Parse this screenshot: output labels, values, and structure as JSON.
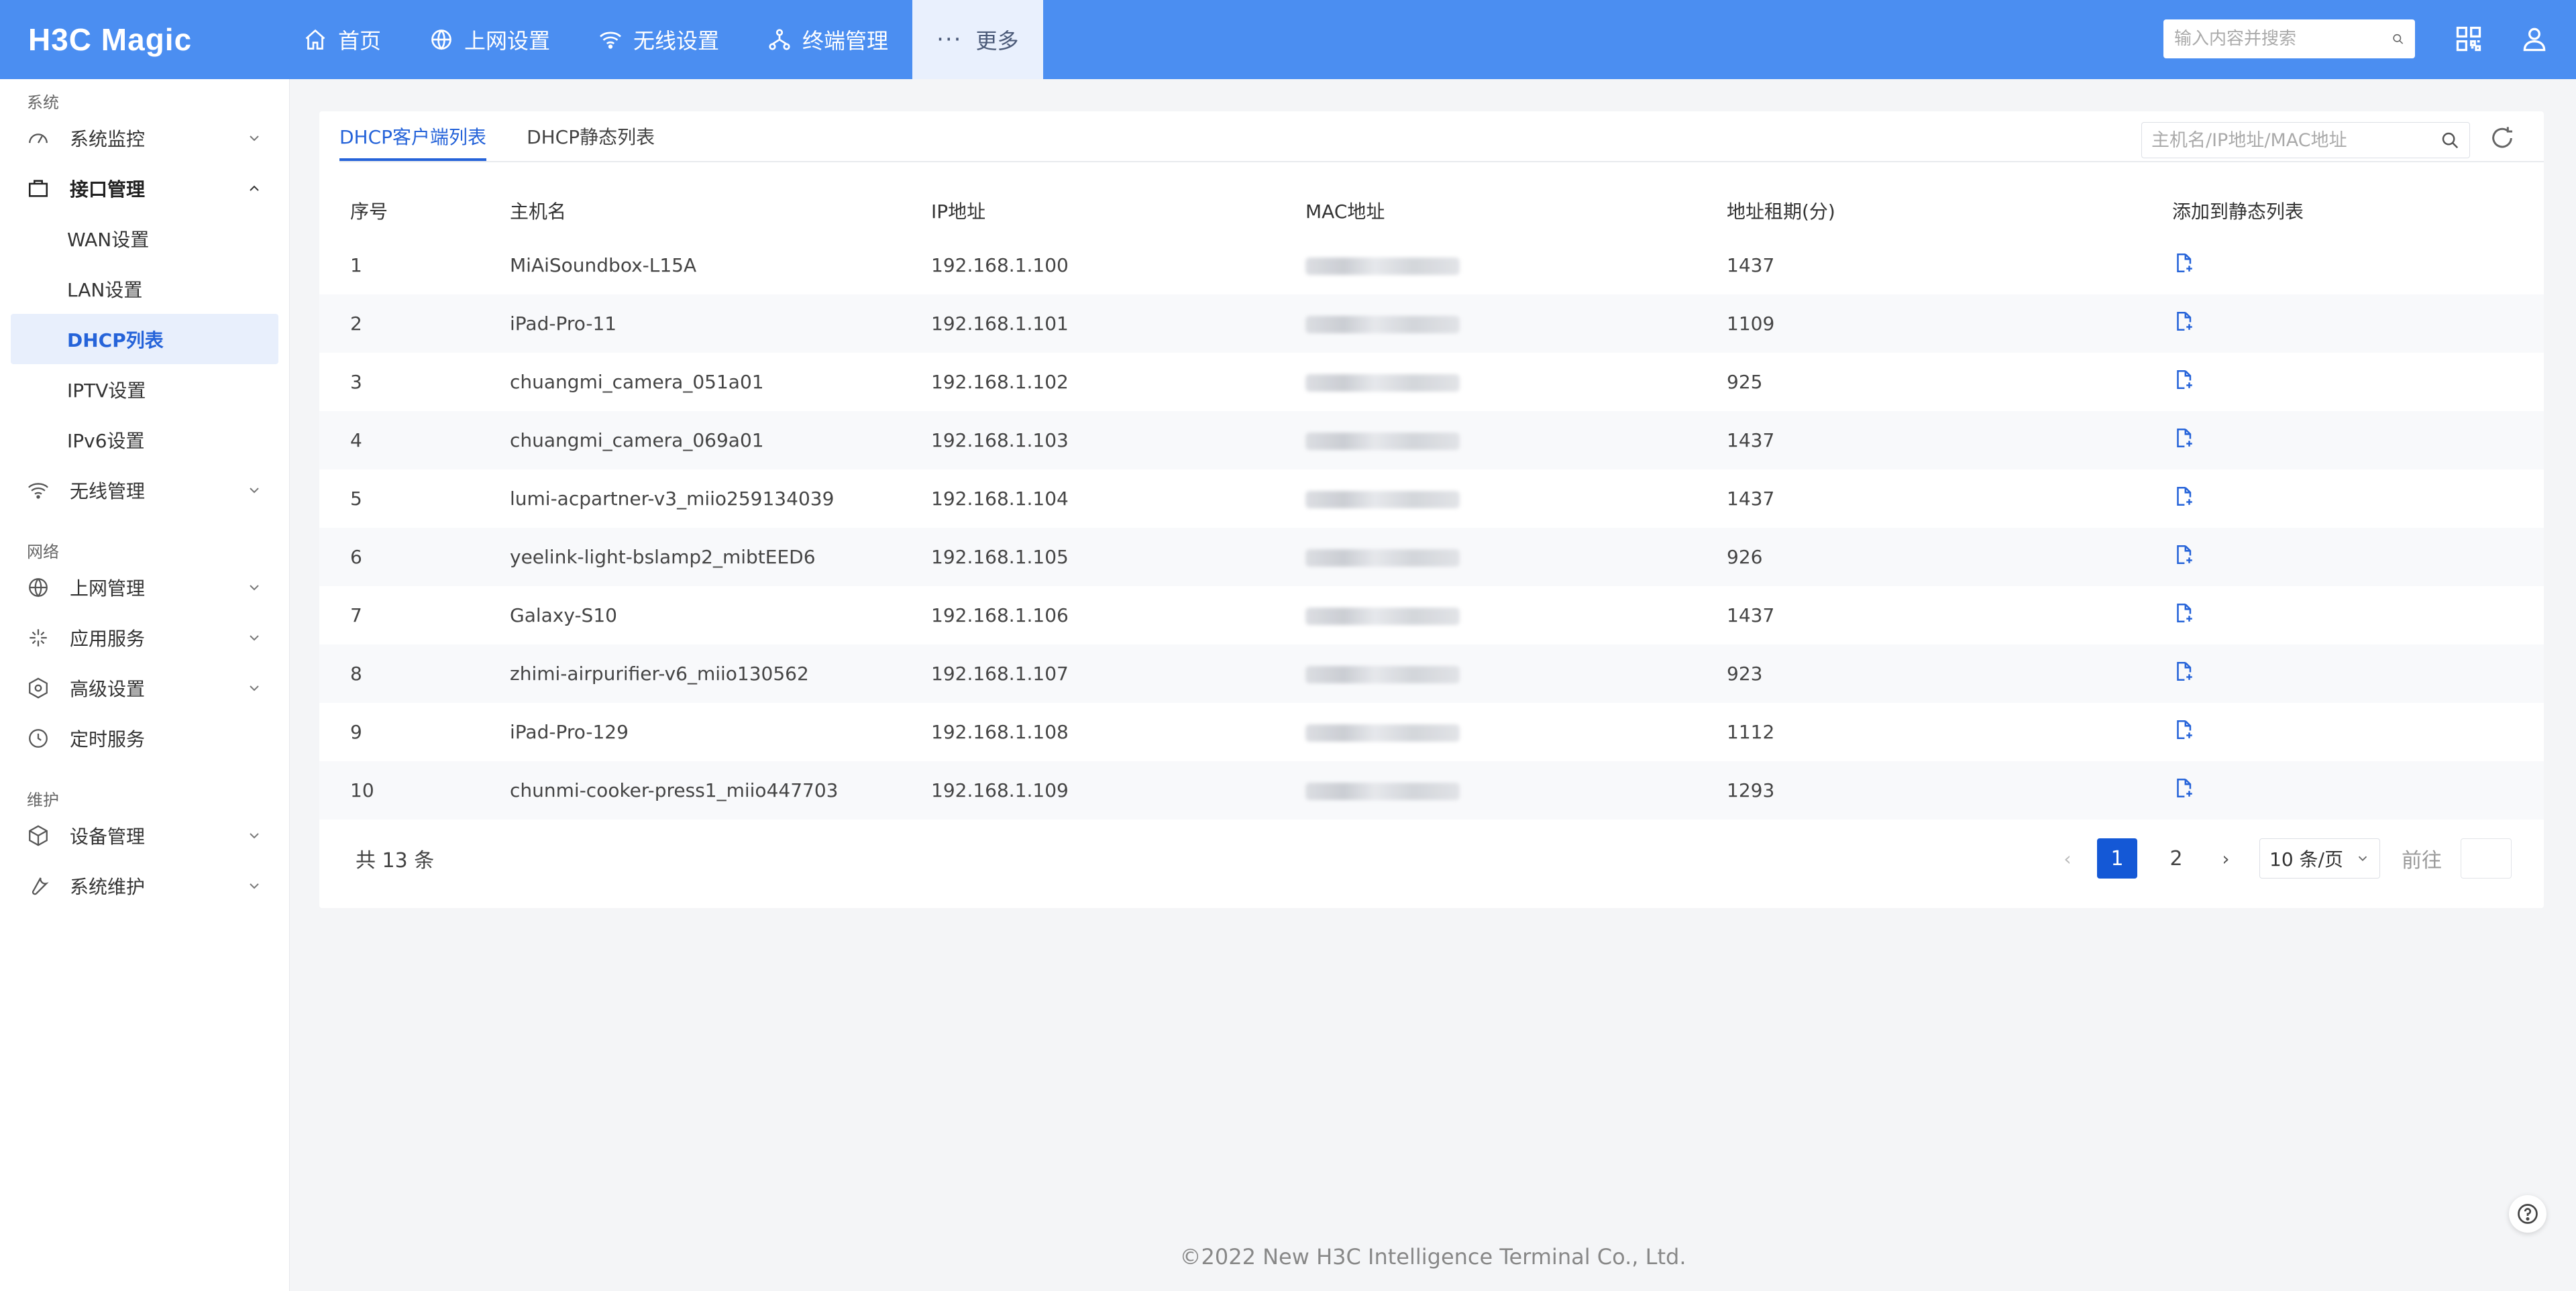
{
  "brand": {
    "logo_text": "H3C Magic"
  },
  "nav": [
    {
      "label": "首页",
      "icon": "home-icon"
    },
    {
      "label": "上网设置",
      "icon": "globe-icon"
    },
    {
      "label": "无线设置",
      "icon": "wifi-icon"
    },
    {
      "label": "终端管理",
      "icon": "network-icon"
    },
    {
      "label": "更多",
      "icon": "more-icon"
    }
  ],
  "top_search": {
    "placeholder": "输入内容并搜索"
  },
  "sidebar": {
    "groups": {
      "system": "系统",
      "network": "网络",
      "maintain": "维护"
    },
    "items": {
      "monitor": "系统监控",
      "interface": "接口管理",
      "wan": "WAN设置",
      "lan": "LAN设置",
      "dhcp": "DHCP列表",
      "iptv": "IPTV设置",
      "ipv6": "IPv6设置",
      "wireless": "无线管理",
      "internet": "上网管理",
      "apps": "应用服务",
      "advanced": "高级设置",
      "timer": "定时服务",
      "device": "设备管理",
      "maintenance": "系统维护"
    }
  },
  "tabs": {
    "clients": "DHCP客户端列表",
    "static": "DHCP静态列表"
  },
  "card_search": {
    "placeholder": "主机名/IP地址/MAC地址"
  },
  "table": {
    "headers": [
      "序号",
      "主机名",
      "IP地址",
      "MAC地址",
      "地址租期(分)",
      "添加到静态列表"
    ],
    "rows": [
      {
        "no": "1",
        "host": "MiAiSoundbox-L15A",
        "ip": "192.168.1.100",
        "lease": "1437"
      },
      {
        "no": "2",
        "host": "iPad-Pro-11",
        "ip": "192.168.1.101",
        "lease": "1109"
      },
      {
        "no": "3",
        "host": "chuangmi_camera_051a01",
        "ip": "192.168.1.102",
        "lease": "925"
      },
      {
        "no": "4",
        "host": "chuangmi_camera_069a01",
        "ip": "192.168.1.103",
        "lease": "1437"
      },
      {
        "no": "5",
        "host": "lumi-acpartner-v3_miio259134039",
        "ip": "192.168.1.104",
        "lease": "1437"
      },
      {
        "no": "6",
        "host": "yeelink-light-bslamp2_mibtEED6",
        "ip": "192.168.1.105",
        "lease": "926"
      },
      {
        "no": "7",
        "host": "Galaxy-S10",
        "ip": "192.168.1.106",
        "lease": "1437"
      },
      {
        "no": "8",
        "host": "zhimi-airpurifier-v6_miio130562",
        "ip": "192.168.1.107",
        "lease": "923"
      },
      {
        "no": "9",
        "host": "iPad-Pro-129",
        "ip": "192.168.1.108",
        "lease": "1112"
      },
      {
        "no": "10",
        "host": "chunmi-cooker-press1_miio447703",
        "ip": "192.168.1.109",
        "lease": "1293"
      }
    ]
  },
  "pagination": {
    "total": "共 13 条",
    "pages": [
      "1",
      "2"
    ],
    "page_size": "10 条/页",
    "goto": "前往"
  },
  "footer": {
    "copyright": "©2022 New H3C Intelligence Terminal Co., Ltd."
  },
  "colors": {
    "primary": "#4b8ef1",
    "accent": "#2563d9",
    "active_page": "#1458d6"
  }
}
